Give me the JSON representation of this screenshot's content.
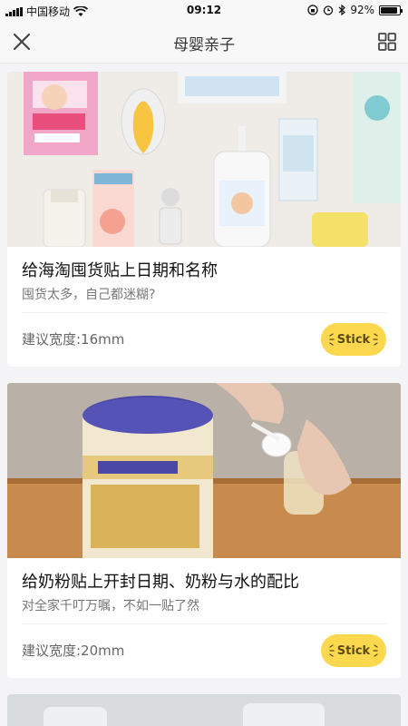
{
  "status_bar": {
    "carrier": "中国移动",
    "time": "09:12",
    "battery": "92%",
    "battery_level": 0.92,
    "icons": [
      "signal-icon",
      "wifi-icon",
      "lock-rotation-icon",
      "alarm-icon",
      "bluetooth-icon",
      "battery-icon"
    ]
  },
  "nav": {
    "title": "母婴亲子",
    "left_icon": "close-icon",
    "right_icon": "grid-icon"
  },
  "cards": [
    {
      "title": "给海淘囤货贴上日期和名称",
      "subtitle": "囤货太多，自己都迷糊?",
      "suggested_width": "建议宽度:16mm",
      "button": "Stick"
    },
    {
      "title": "给奶粉贴上开封日期、奶粉与水的配比",
      "subtitle": "对全家千叮万嘱，不如一贴了然",
      "suggested_width": "建议宽度:20mm",
      "button": "Stick"
    }
  ],
  "colors": {
    "accent": "#fcd84f",
    "background": "#f4f4f6"
  }
}
